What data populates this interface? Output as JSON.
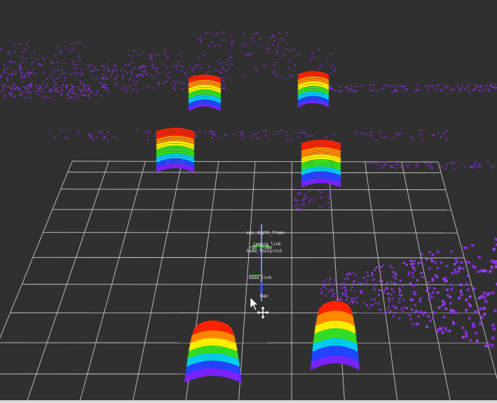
{
  "view": {
    "background": "#303030",
    "grid_color": "#c8c8c8",
    "grid_cells": "10x10"
  },
  "frames": {
    "camera_depth_frame": "mpu_depth_frame",
    "camera_link": "camera_link",
    "camera_rgb_frame": "_rgb_frame",
    "base_footprint": "base_footprint",
    "base_link": "base_link",
    "map": "map"
  },
  "colors": {
    "pointcloud": "#8a2be2",
    "colormap": [
      "#ff2200",
      "#ff8800",
      "#ffee00",
      "#33dd22",
      "#00ccee",
      "#2244ff",
      "#7a22ff"
    ],
    "axis_x": "#ff2020",
    "axis_y": "#20ff20",
    "axis_z": "#3355ff"
  },
  "icons": {
    "cursor": "mouse-pointer-icon",
    "move": "move-camera-icon"
  }
}
